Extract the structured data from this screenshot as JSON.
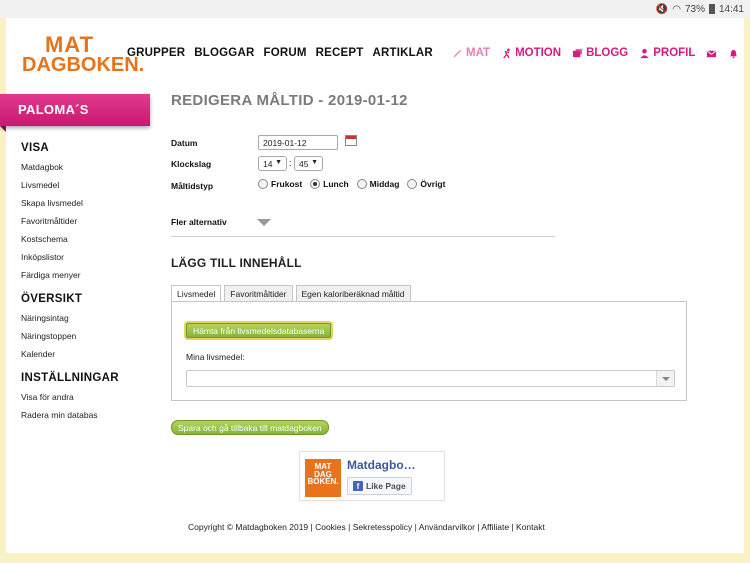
{
  "statusbar": {
    "battery": "73%",
    "time": "14:41"
  },
  "header": {
    "logo_line1": "MAT",
    "logo_line2": "DAGBOKEN.",
    "nav": [
      "GRUPPER",
      "BLOGGAR",
      "FORUM",
      "RECEPT",
      "ARTIKLAR"
    ],
    "user_nav": {
      "mat": "MAT",
      "motion": "MOTION",
      "blogg": "BLOGG",
      "profil": "PROFIL"
    }
  },
  "sidebar": {
    "ribbon": "PALOMA´S",
    "groups": [
      {
        "heading": "VISA",
        "items": [
          "Matdagbok",
          "Livsmedel",
          "Skapa livsmedel",
          "Favoritmåltider",
          "Kostschema",
          "Inköpslistor",
          "Färdiga menyer"
        ]
      },
      {
        "heading": "ÖVERSIKT",
        "items": [
          "Näringsintag",
          "Näringstoppen",
          "Kalender"
        ]
      },
      {
        "heading": "INSTÄLLNINGAR",
        "items": [
          "Visa för andra",
          "Radera min databas"
        ]
      }
    ]
  },
  "main": {
    "title": "REDIGERA MÅLTID - 2019-01-12",
    "form": {
      "datum_label": "Datum",
      "datum_value": "2019-01-12",
      "klockslag_label": "Klockslag",
      "hour": "14",
      "minute": "45",
      "maltidstyp_label": "Måltidstyp",
      "meal_types": [
        "Frukost",
        "Lunch",
        "Middag",
        "Övrigt"
      ],
      "selected_meal": "Lunch",
      "fler_alternativ": "Fler alternativ"
    },
    "add_content": {
      "heading": "LÄGG TILL INNEHÅLL",
      "tabs": [
        "Livsmedel",
        "Favoritmåltider",
        "Egen kaloriberäknad måltid"
      ],
      "active_tab": "Livsmedel",
      "fetch_button": "Hämta från livsmedelsdatabaserna",
      "mina_label": "Mina livsmedel:",
      "mina_value": ""
    },
    "save_button": "Spara och gå tillbaka till matdagboken"
  },
  "fb_widget": {
    "logo_lines": [
      "MAT",
      "DAG",
      "BOKEN."
    ],
    "page_name": "Matdagbo…",
    "like_label": "Like Page"
  },
  "footer": {
    "text": "Copyright © Matdagboken 2019 | Cookies | Sekretesspolicy | Användarvilkor | Affiliate | Kontakt"
  },
  "colors": {
    "brand_orange": "#e8731b",
    "brand_pink": "#d81b7e",
    "button_green": "#86b33a",
    "fb_blue": "#3b5998"
  }
}
